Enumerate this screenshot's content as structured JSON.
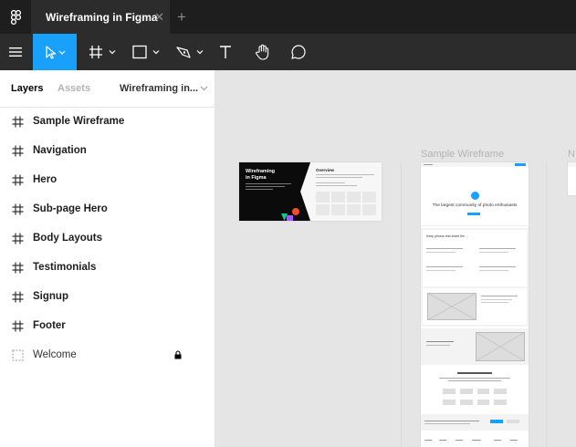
{
  "tabbar": {
    "file_title": "Wireframing in Figma",
    "close_glyph": "✕",
    "add_glyph": "+"
  },
  "toolbar": {
    "tools": [
      "menu-icon",
      "move-tool-icon",
      "frame-tool-icon",
      "shape-tool-icon",
      "pen-tool-icon",
      "text-tool-icon",
      "hand-tool-icon",
      "comment-tool-icon"
    ],
    "accent": "#18a0fb"
  },
  "sidebar": {
    "tabs": [
      "Layers",
      "Assets"
    ],
    "page_name": "Wireframing in...",
    "layers": [
      {
        "label": "Sample Wireframe"
      },
      {
        "label": "Navigation"
      },
      {
        "label": "Hero"
      },
      {
        "label": "Sub-page Hero"
      },
      {
        "label": "Body Layouts"
      },
      {
        "label": "Testimonials"
      },
      {
        "label": "Signup"
      },
      {
        "label": "Footer"
      },
      {
        "label": "Welcome"
      }
    ]
  },
  "canvas": {
    "frame_label": "Sample Wireframe",
    "cover_title_line1": "Wireframing",
    "cover_title_line2": "in Figma",
    "cover_overview": "Overview",
    "hero_tagline": "The largest community of photo enthusiasts",
    "section_heading": "Keep photos and share the ... "
  }
}
